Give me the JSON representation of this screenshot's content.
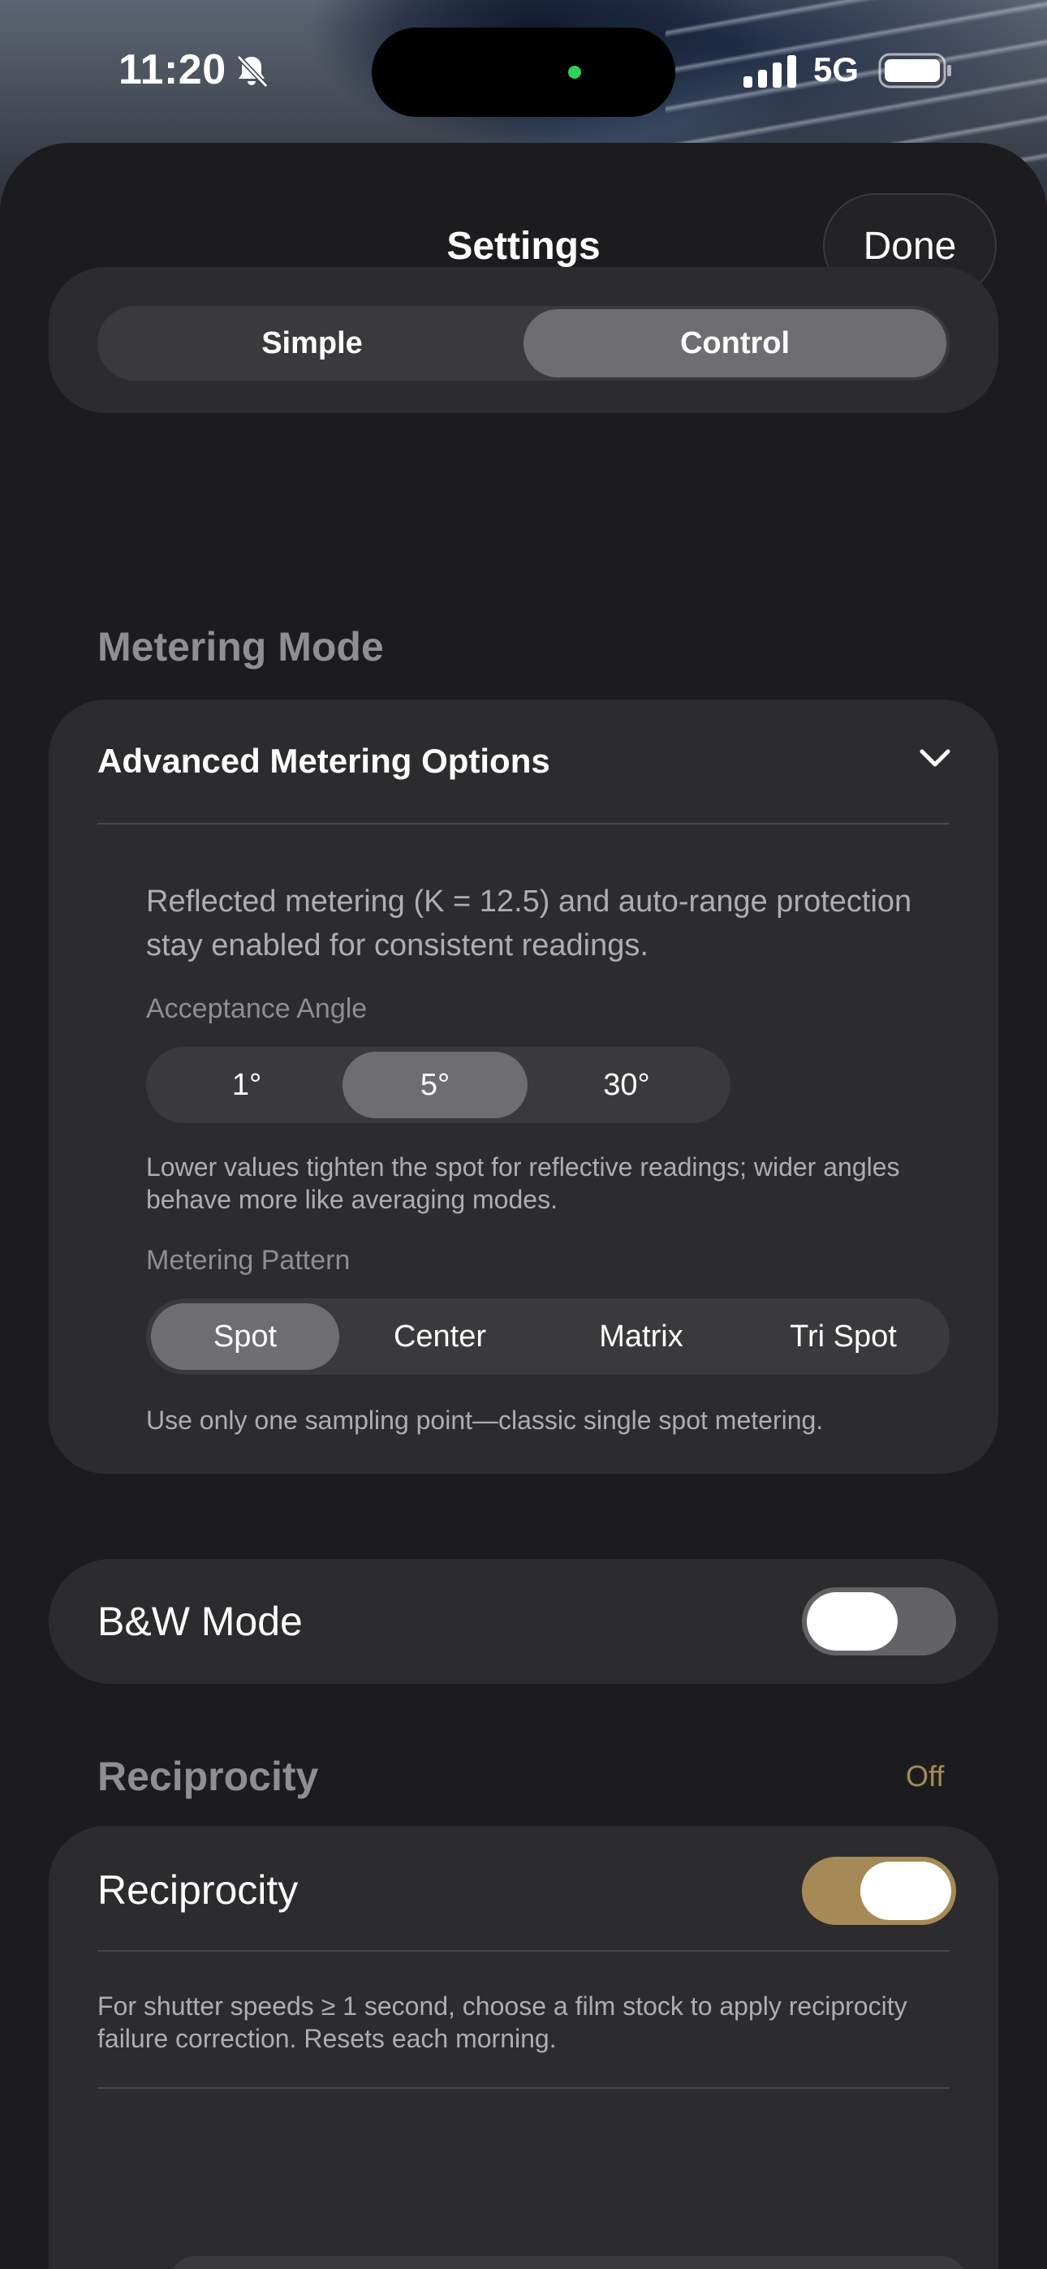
{
  "status_bar": {
    "time": "11:20",
    "network": "5G"
  },
  "header": {
    "title": "Settings",
    "done_label": "Done"
  },
  "mode_selector": {
    "options": [
      "Simple",
      "Control"
    ],
    "selected": "Control"
  },
  "metering": {
    "section_title": "Metering Mode",
    "card_title": "Advanced Metering Options",
    "description": "Reflected metering (K = 12.5) and auto-range protection stay enabled for consistent readings.",
    "angle_label": "Acceptance Angle",
    "angles": [
      "1°",
      "5°",
      "30°"
    ],
    "angle_selected": "5°",
    "angle_hint": "Lower values tighten the spot for reflective readings; wider angles behave more like averaging modes.",
    "pattern_label": "Metering Pattern",
    "patterns": [
      "Spot",
      "Center",
      "Matrix",
      "Tri Spot"
    ],
    "pattern_selected": "Spot",
    "pattern_hint": "Use only one sampling point—classic single spot metering."
  },
  "bw_mode": {
    "label": "B&W Mode",
    "enabled": false
  },
  "reciprocity": {
    "section_title": "Reciprocity",
    "section_status": "Off",
    "toggle_label": "Reciprocity",
    "enabled": true,
    "hint": "For shutter speeds ≥ 1 second, choose a film stock to apply reciprocity failure correction. Resets each morning."
  },
  "colors": {
    "accent": "#a58a57",
    "sheet": "#1c1c1e",
    "card": "#2c2c2e",
    "segment_active": "#6d6d72"
  }
}
